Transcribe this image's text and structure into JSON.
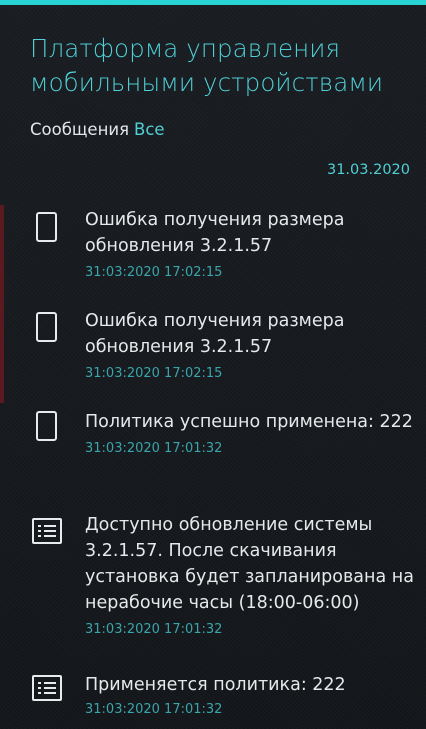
{
  "app": {
    "title": "Платформа управления мобильными устройствами"
  },
  "subtitle": {
    "label": "Сообщения",
    "filter": "Все"
  },
  "date_header": "31.03.2020",
  "colors": {
    "accent": "#4fd0d6",
    "top_strip": "#2ad3d3",
    "timestamp": "#3aa5ab",
    "background": "#16191d",
    "unread_marker": "#5a1a1f"
  },
  "messages": [
    {
      "icon": "device-icon",
      "text": "Ошибка получения размера обновления 3.2.1.57",
      "time": "31:03:2020 17:02:15"
    },
    {
      "icon": "device-icon",
      "text": "Ошибка получения размера обновления 3.2.1.57",
      "time": "31:03:2020 17:02:15"
    },
    {
      "icon": "device-icon",
      "text": "Политика успешно применена: 222",
      "time": "31:03:2020 17:01:32"
    },
    {
      "icon": "list-icon",
      "text": "Доступно обновление системы 3.2.1.57. После скачивания установка будет запланирована на нерабочие часы (18:00-06:00)",
      "time": "31:03:2020 17:01:32"
    },
    {
      "icon": "list-icon",
      "text": "Применяется политика: 222",
      "time": "31:03:2020 17:01:32"
    }
  ]
}
